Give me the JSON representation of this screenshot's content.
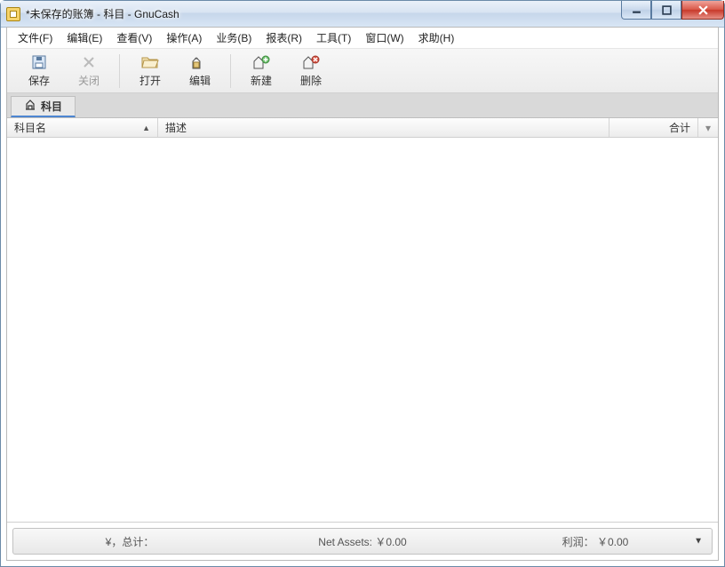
{
  "window": {
    "title": "*未保存的账簿 - 科目 - GnuCash"
  },
  "menu": {
    "file": "文件(F)",
    "edit": "编辑(E)",
    "view": "查看(V)",
    "actions": "操作(A)",
    "business": "业务(B)",
    "reports": "报表(R)",
    "tools": "工具(T)",
    "windows": "窗口(W)",
    "help": "求助(H)"
  },
  "toolbar": {
    "save": "保存",
    "close": "关闭",
    "open": "打开",
    "edit": "编辑",
    "new": "新建",
    "delete": "删除"
  },
  "tab": {
    "label": "科目"
  },
  "columns": {
    "name": "科目名",
    "desc": "描述",
    "total": "合计"
  },
  "status": {
    "currency_total": "¥，总计：",
    "net_assets": "Net Assets: ￥0.00",
    "profit": "利润： ￥0.00"
  }
}
